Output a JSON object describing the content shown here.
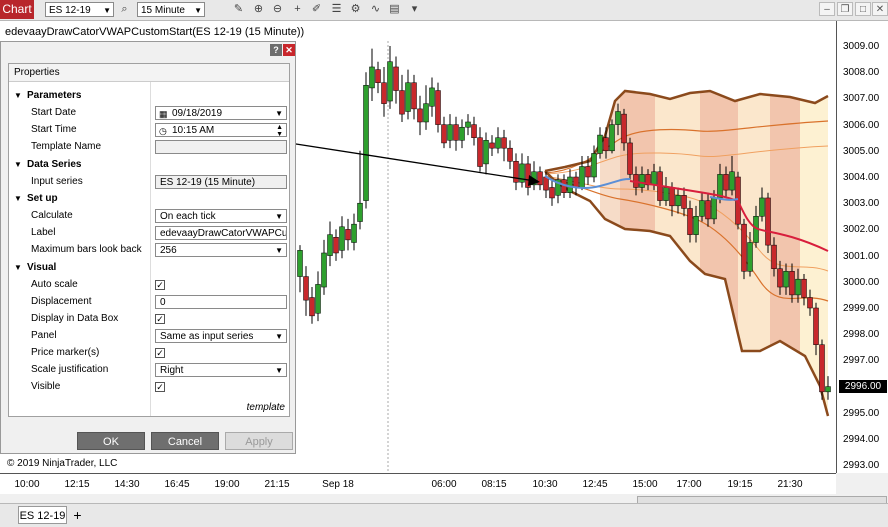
{
  "toolbar": {
    "chart_tab": "Chart",
    "instrument": "ES 12-19",
    "interval": "15 Minute",
    "icons": [
      "search-icon",
      "pencil-icon",
      "zoom-in-icon",
      "zoom-out-icon",
      "crosshair-icon",
      "drawing-icon",
      "properties-icon",
      "strategy-icon",
      "indicator-icon",
      "data-box-icon"
    ]
  },
  "chart": {
    "title": "edevaayDrawCatorVWAPCustomStart(ES 12-19 (15 Minute))",
    "copyright": "© 2019 NinjaTrader, LLC",
    "current_price": "2996.00",
    "price_labels": [
      "3009.00",
      "3008.00",
      "3007.00",
      "3006.00",
      "3005.00",
      "3004.00",
      "3003.00",
      "3002.00",
      "3001.00",
      "3000.00",
      "2999.00",
      "2998.00",
      "2997.00",
      "2996.00",
      "2995.00",
      "2994.00",
      "2993.00"
    ],
    "time_labels": [
      "10:00",
      "12:15",
      "14:30",
      "16:45",
      "19:00",
      "21:15",
      "Sep 18",
      "06:00",
      "08:15",
      "10:30",
      "12:45",
      "15:00",
      "17:00",
      "19:15",
      "21:30"
    ]
  },
  "dialog": {
    "header": "Properties",
    "sections": {
      "parameters": "Parameters",
      "data_series": "Data Series",
      "setup": "Set up",
      "visual": "Visual"
    },
    "params": {
      "start_date_label": "Start Date",
      "start_date_value": "09/18/2019",
      "start_time_label": "Start Time",
      "start_time_value": "10:15 AM",
      "template_name_label": "Template Name",
      "template_name_value": ""
    },
    "data_series": {
      "input_label": "Input series",
      "input_value": "ES 12-19 (15 Minute)"
    },
    "setup": {
      "calculate_label": "Calculate",
      "calculate_value": "On each tick",
      "label_label": "Label",
      "label_value": "edevaayDrawCatorVWAPCustomStart",
      "max_bars_label": "Maximum bars look back",
      "max_bars_value": "256"
    },
    "visual": {
      "auto_scale": "Auto scale",
      "displacement_label": "Displacement",
      "displacement_value": "0",
      "display_in_data_box": "Display in Data Box",
      "panel_label": "Panel",
      "panel_value": "Same as input series",
      "price_markers": "Price marker(s)",
      "scale_justification_label": "Scale justification",
      "scale_justification_value": "Right",
      "visible": "Visible"
    },
    "template_link": "template",
    "buttons": {
      "ok": "OK",
      "cancel": "Cancel",
      "apply": "Apply"
    }
  },
  "bottom": {
    "tab": "ES 12-19",
    "add": "+"
  }
}
